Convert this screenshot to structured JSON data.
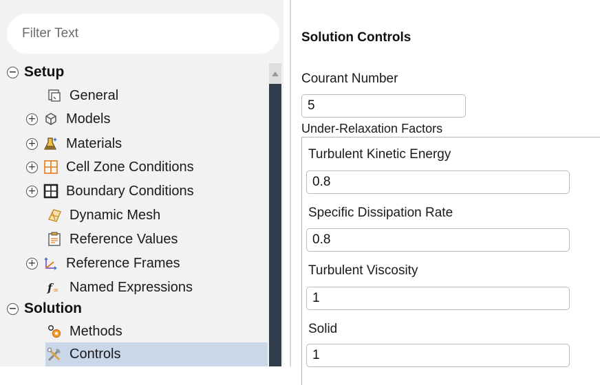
{
  "filter": {
    "placeholder": "Filter Text"
  },
  "tree": {
    "setup": {
      "label": "Setup",
      "toggle": "−"
    },
    "items": [
      {
        "label": "General",
        "icon": "general-icon",
        "toggle": ""
      },
      {
        "label": "Models",
        "icon": "models-icon",
        "toggle": "+"
      },
      {
        "label": "Materials",
        "icon": "materials-icon",
        "toggle": "+"
      },
      {
        "label": "Cell Zone Conditions",
        "icon": "cell-zone-icon",
        "toggle": "+"
      },
      {
        "label": "Boundary Conditions",
        "icon": "boundary-icon",
        "toggle": "+"
      },
      {
        "label": "Dynamic Mesh",
        "icon": "dynamic-mesh-icon",
        "toggle": ""
      },
      {
        "label": "Reference Values",
        "icon": "reference-values-icon",
        "toggle": ""
      },
      {
        "label": "Reference Frames",
        "icon": "reference-frames-icon",
        "toggle": "+"
      },
      {
        "label": "Named Expressions",
        "icon": "named-expressions-icon",
        "toggle": ""
      }
    ],
    "solution": {
      "label": "Solution",
      "toggle": "−"
    },
    "solution_items": [
      {
        "label": "Methods",
        "icon": "methods-icon"
      },
      {
        "label": "Controls",
        "icon": "controls-icon",
        "selected": true
      }
    ]
  },
  "panel": {
    "title": "Solution Controls",
    "courant": {
      "label": "Courant Number",
      "value": "5"
    },
    "urf_title": "Under-Relaxation Factors",
    "fields": [
      {
        "label": "Turbulent Kinetic Energy",
        "value": "0.8"
      },
      {
        "label": "Specific Dissipation Rate",
        "value": "0.8"
      },
      {
        "label": "Turbulent Viscosity",
        "value": "1"
      },
      {
        "label": "Solid",
        "value": "1"
      }
    ]
  },
  "colors": {
    "selection": "#c9d7e9",
    "scroll_thumb": "#2f3d4c",
    "panel_bg": "#f2f2f2"
  }
}
